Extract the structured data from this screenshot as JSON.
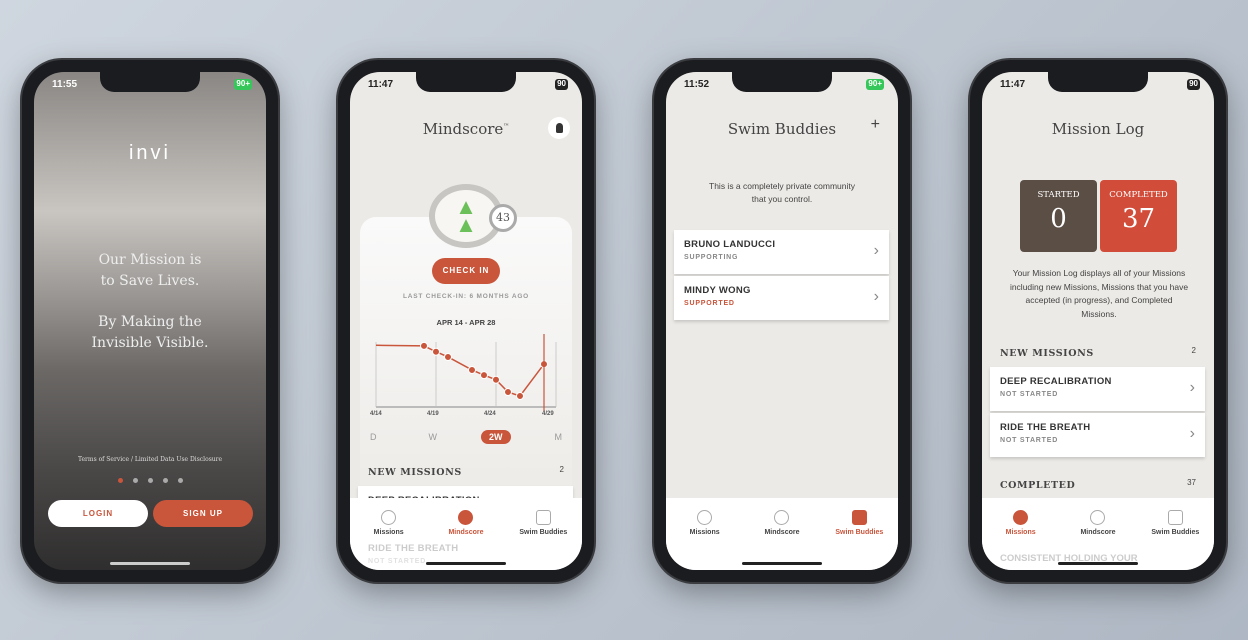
{
  "colors": {
    "accent": "#c9553b",
    "dark_box": "#5b4e45",
    "green": "#6cc05a"
  },
  "welcome": {
    "time": "11:55",
    "battery": "90+",
    "logo": "INVI",
    "line1": "Our Mission is",
    "line2": "to Save Lives.",
    "line3": "By Making the",
    "line4": "Invisible Visible.",
    "legal": "Terms of Service / Limited Data Use Disclosure",
    "page_dots": 5,
    "active_dot": 1,
    "login": "LOGIN",
    "signup": "SIGN UP"
  },
  "mindscore": {
    "time": "11:47",
    "battery": "90",
    "title": "Mindscore",
    "tm": "™",
    "score": "43",
    "check_in": "CHECK IN",
    "last_check_in": "LAST CHECK-IN: 6 MONTHS AGO",
    "range": "APR 14 - APR 28",
    "periods": [
      "D",
      "W",
      "2W",
      "M"
    ],
    "active_period": "2W",
    "new_missions": "NEW MISSIONS",
    "new_count": "2",
    "peek1": "DEEP RECALIBRATION",
    "peek2": "RIDE THE BREATH",
    "peek2_status": "NOT STARTED"
  },
  "chart_data": {
    "type": "line",
    "x_ticks": [
      "4/14",
      "4/19",
      "4/24",
      "4/29"
    ],
    "x": [
      "4/14",
      "4/18",
      "4/19",
      "4/20",
      "4/22",
      "4/23",
      "4/24",
      "4/25",
      "4/26",
      "4/28"
    ],
    "values": [
      95,
      94,
      85,
      77,
      57,
      49,
      42,
      23,
      17,
      66
    ],
    "ylim": [
      0,
      100
    ],
    "grid": true,
    "marker_at": "4/28"
  },
  "swim": {
    "time": "11:52",
    "battery": "90+",
    "title": "Swim Buddies",
    "add": "+",
    "intro": "This is a completely private community that you control.",
    "buddies": [
      {
        "name": "BRUNO LANDUCCI",
        "status": "SUPPORTING"
      },
      {
        "name": "MINDY WONG",
        "status": "SUPPORTED"
      }
    ]
  },
  "log": {
    "time": "11:47",
    "battery": "90",
    "title": "Mission Log",
    "started_label": "STARTED",
    "started": "0",
    "completed_label": "COMPLETED",
    "completed": "37",
    "intro": "Your Mission Log displays all of your Missions including new Missions, Missions that you have accepted (in progress), and Completed Missions.",
    "new_missions": "NEW MISSIONS",
    "new_count": "2",
    "missions": [
      {
        "name": "DEEP RECALIBRATION",
        "status": "NOT STARTED"
      },
      {
        "name": "RIDE THE BREATH",
        "status": "NOT STARTED"
      }
    ],
    "completed_section": "COMPLETED",
    "completed_count": "37",
    "peek": "CONSISTENT HOLDING YOUR"
  },
  "tabs": {
    "missions": "Missions",
    "mindscore": "Mindscore",
    "swim": "Swim Buddies"
  }
}
